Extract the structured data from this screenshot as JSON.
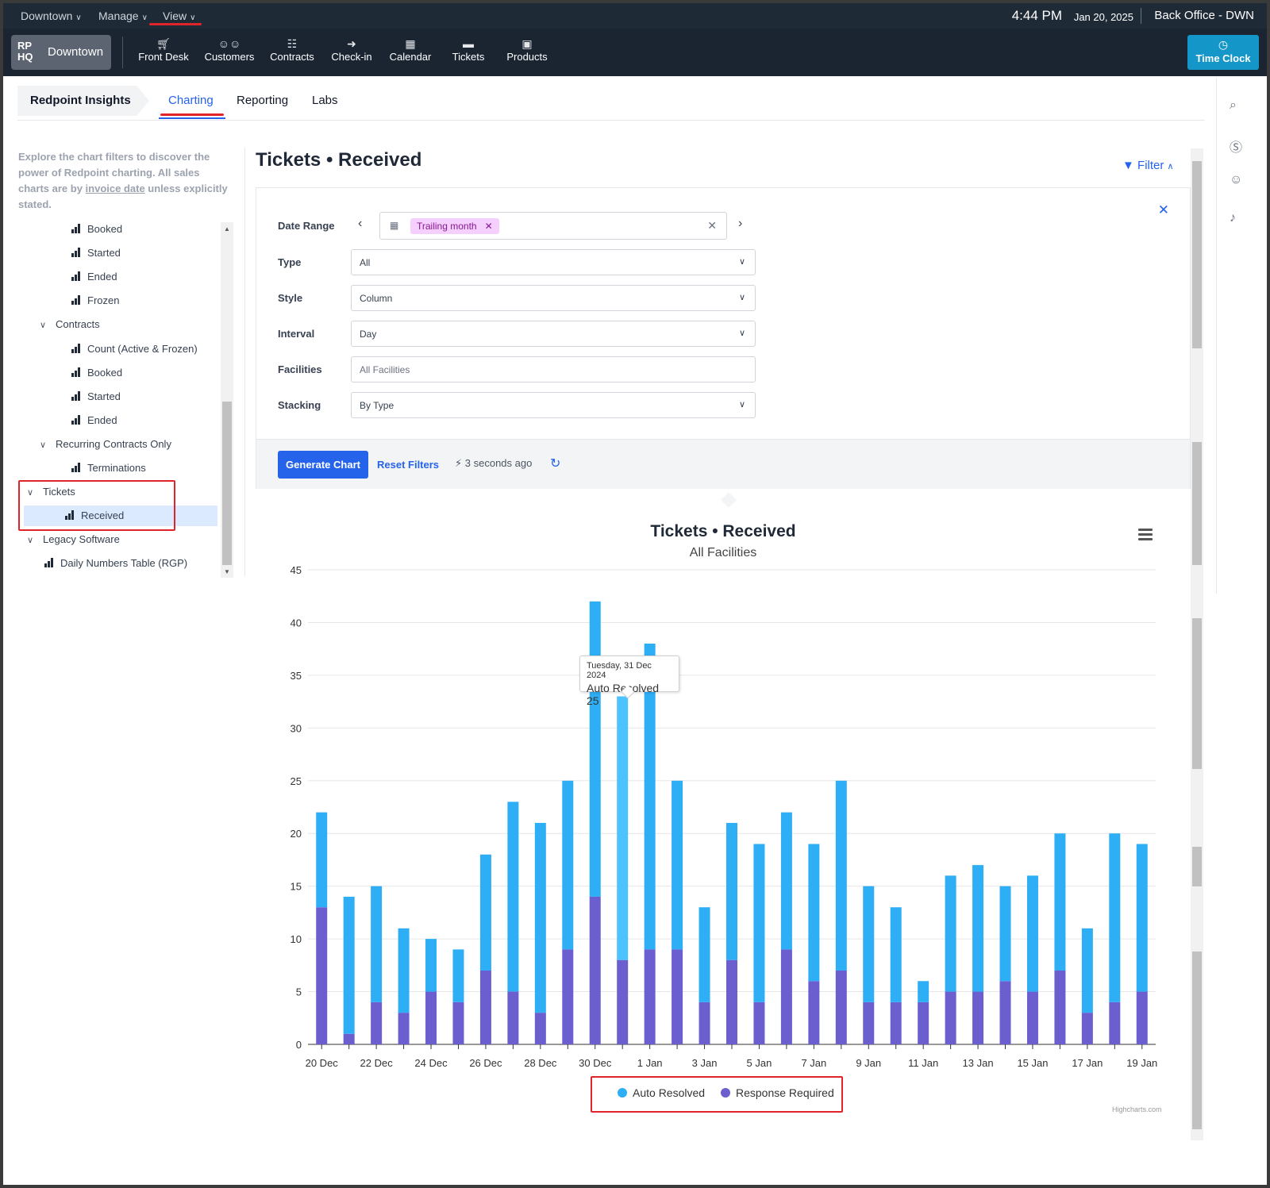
{
  "menubar": {
    "items": [
      "Downtown",
      "Manage",
      "View"
    ],
    "time": "4:44 PM",
    "date": "Jan 20, 2025",
    "office": "Back Office - DWN"
  },
  "navbar": {
    "brand_logo": "RP HQ",
    "brand_name": "Downtown",
    "items": [
      {
        "label": "Front Desk",
        "icon": "cart-icon"
      },
      {
        "label": "Customers",
        "icon": "users-icon"
      },
      {
        "label": "Contracts",
        "icon": "contracts-icon"
      },
      {
        "label": "Check-in",
        "icon": "checkin-icon"
      },
      {
        "label": "Calendar",
        "icon": "calendar-icon"
      },
      {
        "label": "Tickets",
        "icon": "chat-icon"
      },
      {
        "label": "Products",
        "icon": "box-icon"
      }
    ],
    "timeclock": "Time Clock"
  },
  "tabs": {
    "insights": "Redpoint Insights",
    "charting": "Charting",
    "reporting": "Reporting",
    "labs": "Labs"
  },
  "sidebar": {
    "intro_1": "Explore the chart filters to discover the power of Redpoint charting. All sales charts are by ",
    "intro_link": "invoice date",
    "intro_2": " unless explicitly stated.",
    "tree": [
      {
        "label": "Booked",
        "type": "leaf",
        "level": 2
      },
      {
        "label": "Started",
        "type": "leaf",
        "level": 2
      },
      {
        "label": "Ended",
        "type": "leaf",
        "level": 2
      },
      {
        "label": "Frozen",
        "type": "leaf",
        "level": 2
      },
      {
        "label": "Contracts",
        "type": "group",
        "level": 1
      },
      {
        "label": "Count (Active & Frozen)",
        "type": "leaf",
        "level": 2
      },
      {
        "label": "Booked",
        "type": "leaf",
        "level": 2
      },
      {
        "label": "Started",
        "type": "leaf",
        "level": 2
      },
      {
        "label": "Ended",
        "type": "leaf",
        "level": 2
      },
      {
        "label": "Recurring Contracts Only",
        "type": "group",
        "level": 1
      },
      {
        "label": "Terminations",
        "type": "leaf",
        "level": 2
      },
      {
        "label": "Tickets",
        "type": "group",
        "level": 0
      },
      {
        "label": "Received",
        "type": "leaf",
        "level": 1,
        "selected": true
      },
      {
        "label": "Legacy Software",
        "type": "group",
        "level": 0
      },
      {
        "label": "Daily Numbers Table (RGP)",
        "type": "leaf",
        "level": 1
      }
    ]
  },
  "main": {
    "title": "Tickets • Received",
    "filter_link": "Filter",
    "filters": {
      "date_range_label": "Date Range",
      "date_range_chip": "Trailing month",
      "type_label": "Type",
      "type_value": "All",
      "style_label": "Style",
      "style_value": "Column",
      "interval_label": "Interval",
      "interval_value": "Day",
      "facilities_label": "Facilities",
      "facilities_placeholder": "All Facilities",
      "stacking_label": "Stacking",
      "stacking_value": "By Type"
    },
    "generate": "Generate Chart",
    "reset": "Reset Filters",
    "last_run": "3 seconds ago"
  },
  "chart_data": {
    "type": "bar",
    "stacked": true,
    "title": "Tickets • Received",
    "subtitle": "All Facilities",
    "ylim": [
      0,
      45
    ],
    "yticks": [
      0,
      5,
      10,
      15,
      20,
      25,
      30,
      35,
      40,
      45
    ],
    "categories": [
      "20 Dec",
      "21 Dec",
      "22 Dec",
      "23 Dec",
      "24 Dec",
      "25 Dec",
      "26 Dec",
      "27 Dec",
      "28 Dec",
      "29 Dec",
      "30 Dec",
      "31 Dec",
      "1 Jan",
      "2 Jan",
      "3 Jan",
      "4 Jan",
      "5 Jan",
      "6 Jan",
      "7 Jan",
      "8 Jan",
      "9 Jan",
      "10 Jan",
      "11 Jan",
      "12 Jan",
      "13 Jan",
      "14 Jan",
      "15 Jan",
      "16 Jan",
      "17 Jan",
      "18 Jan",
      "19 Jan"
    ],
    "xtick_labels": [
      "20 Dec",
      "22 Dec",
      "24 Dec",
      "26 Dec",
      "28 Dec",
      "30 Dec",
      "1 Jan",
      "3 Jan",
      "5 Jan",
      "7 Jan",
      "9 Jan",
      "11 Jan",
      "13 Jan",
      "15 Jan",
      "17 Jan",
      "19 Jan"
    ],
    "series": [
      {
        "name": "Auto Resolved",
        "color": "#2eaef5",
        "values": [
          9,
          13,
          11,
          8,
          5,
          5,
          11,
          18,
          18,
          16,
          28,
          25,
          29,
          16,
          9,
          13,
          15,
          13,
          13,
          18,
          11,
          9,
          2,
          11,
          12,
          9,
          11,
          13,
          8,
          16,
          14
        ]
      },
      {
        "name": "Response Required",
        "color": "#6b5fcf",
        "values": [
          13,
          1,
          4,
          3,
          5,
          4,
          7,
          5,
          3,
          9,
          14,
          8,
          9,
          9,
          4,
          8,
          4,
          9,
          6,
          7,
          4,
          4,
          4,
          5,
          5,
          6,
          5,
          7,
          3,
          4,
          5
        ]
      }
    ],
    "highlight_index": 11,
    "legend": "bottom-center",
    "tooltip": {
      "date": "Tuesday, 31 Dec 2024",
      "series": "Auto Resolved",
      "value": "25"
    },
    "credits": "Highcharts.com"
  }
}
